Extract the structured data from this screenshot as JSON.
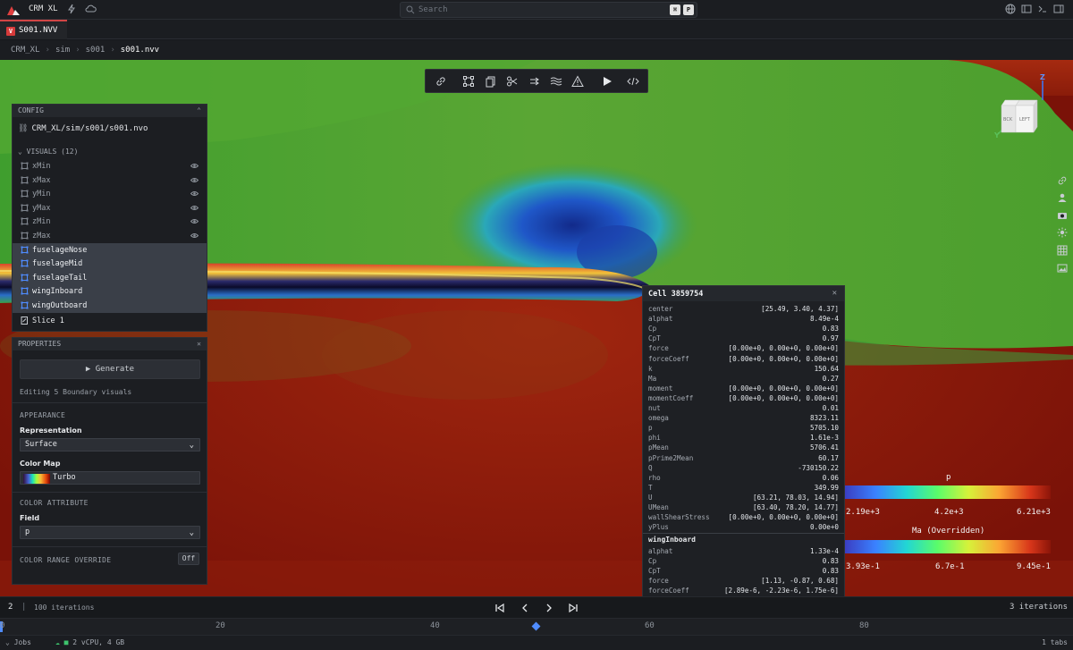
{
  "app": {
    "title": "CRM XL"
  },
  "search": {
    "placeholder": "Search",
    "key1": "⌘",
    "key2": "P"
  },
  "tab": {
    "badge": "V",
    "label": "S001.NVV"
  },
  "breadcrumb": [
    "CRM_XL",
    "sim",
    "s001",
    "s001.nvv"
  ],
  "config": {
    "title": "CONFIG",
    "path": "CRM_XL/sim/s001/s001.nvo",
    "visuals_header": "VISUALS (12)",
    "visuals": [
      {
        "label": "xMin",
        "selected": false
      },
      {
        "label": "xMax",
        "selected": false
      },
      {
        "label": "yMin",
        "selected": false
      },
      {
        "label": "yMax",
        "selected": false
      },
      {
        "label": "zMin",
        "selected": false
      },
      {
        "label": "zMax",
        "selected": false
      },
      {
        "label": "fuselageNose",
        "selected": true
      },
      {
        "label": "fuselageMid",
        "selected": true
      },
      {
        "label": "fuselageTail",
        "selected": true
      },
      {
        "label": "wingInboard",
        "selected": true
      },
      {
        "label": "wingOutboard",
        "selected": true
      }
    ],
    "slice_label": "Slice 1"
  },
  "properties": {
    "title": "PROPERTIES",
    "generate_label": "Generate",
    "editing_text": "Editing 5 Boundary visuals",
    "appearance": "APPEARANCE",
    "representation_label": "Representation",
    "representation_value": "Surface",
    "colormap_label": "Color Map",
    "colormap_value": "Turbo",
    "color_attribute": "COLOR ATTRIBUTE",
    "field_label": "Field",
    "field_value": "p",
    "range_override": "COLOR RANGE OVERRIDE",
    "range_override_state": "Off"
  },
  "cell": {
    "title": "Cell 3859754",
    "rows": [
      {
        "k": "center",
        "v": "[25.49, 3.40, 4.37]"
      },
      {
        "k": "alphat",
        "v": "8.49e-4"
      },
      {
        "k": "Cp",
        "v": "0.83"
      },
      {
        "k": "CpT",
        "v": "0.97"
      },
      {
        "k": "force",
        "v": "[0.00e+0, 0.00e+0, 0.00e+0]"
      },
      {
        "k": "forceCoeff",
        "v": "[0.00e+0, 0.00e+0, 0.00e+0]"
      },
      {
        "k": "k",
        "v": "150.64"
      },
      {
        "k": "Ma",
        "v": "0.27"
      },
      {
        "k": "moment",
        "v": "[0.00e+0, 0.00e+0, 0.00e+0]"
      },
      {
        "k": "momentCoeff",
        "v": "[0.00e+0, 0.00e+0, 0.00e+0]"
      },
      {
        "k": "nut",
        "v": "0.01"
      },
      {
        "k": "omega",
        "v": "8323.11"
      },
      {
        "k": "p",
        "v": "5705.10"
      },
      {
        "k": "phi",
        "v": "1.61e-3"
      },
      {
        "k": "pMean",
        "v": "5706.41"
      },
      {
        "k": "pPrime2Mean",
        "v": "60.17"
      },
      {
        "k": "Q",
        "v": "-730150.22"
      },
      {
        "k": "rho",
        "v": "0.06"
      },
      {
        "k": "T",
        "v": "349.99"
      },
      {
        "k": "U",
        "v": "[63.21, 78.03, 14.94]"
      },
      {
        "k": "UMean",
        "v": "[63.40, 78.20, 14.77]"
      },
      {
        "k": "wallShearStress",
        "v": "[0.00e+0, 0.00e+0, 0.00e+0]"
      },
      {
        "k": "yPlus",
        "v": "0.00e+0"
      }
    ],
    "section2_title": "wingInboard",
    "rows2": [
      {
        "k": "alphat",
        "v": "1.33e-4"
      },
      {
        "k": "Cp",
        "v": "0.83"
      },
      {
        "k": "CpT",
        "v": "0.83"
      },
      {
        "k": "force",
        "v": "[1.13, -0.87, 0.68]"
      },
      {
        "k": "forceCoeff",
        "v": "[2.89e-6, -2.23e-6, 1.75e-6]"
      },
      {
        "k": "k",
        "v": "150.64"
      },
      {
        "k": "Ma",
        "v": "0.00e+0"
      },
      {
        "k": "moment",
        "v": "[2.20, 5.44, 3.28]"
      },
      {
        "k": "momentCoeff",
        "v": "[8.05e-7, 1.99e-6, 1.20e-6]"
      },
      {
        "k": "nut",
        "v": "2.00e-3"
      },
      {
        "k": "omega",
        "v": "8323.11"
      }
    ]
  },
  "legends": [
    {
      "title": "p",
      "min": "2.19e+3",
      "mid": "4.2e+3",
      "max": "6.21e+3"
    },
    {
      "title": "Ma (Overridden)",
      "min": "3.93e-1",
      "mid": "6.7e-1",
      "max": "9.45e-1"
    }
  ],
  "timeline": {
    "current": "2",
    "separator": "|",
    "count_label": "100 iterations",
    "right_label": "3 iterations",
    "ticks": [
      "0",
      "20",
      "40",
      "60",
      "80"
    ]
  },
  "status": {
    "jobs": "Jobs",
    "vcpu": "2 vCPU, 4 GB",
    "tabs": "1 tabs"
  },
  "navcube": {
    "axis_z": "Z",
    "axis_y": "Y",
    "face_left": "LEFT",
    "face_back": "BCK"
  },
  "colors": {
    "accent": "#4f8cff",
    "brand_red": "#d63a3a"
  }
}
